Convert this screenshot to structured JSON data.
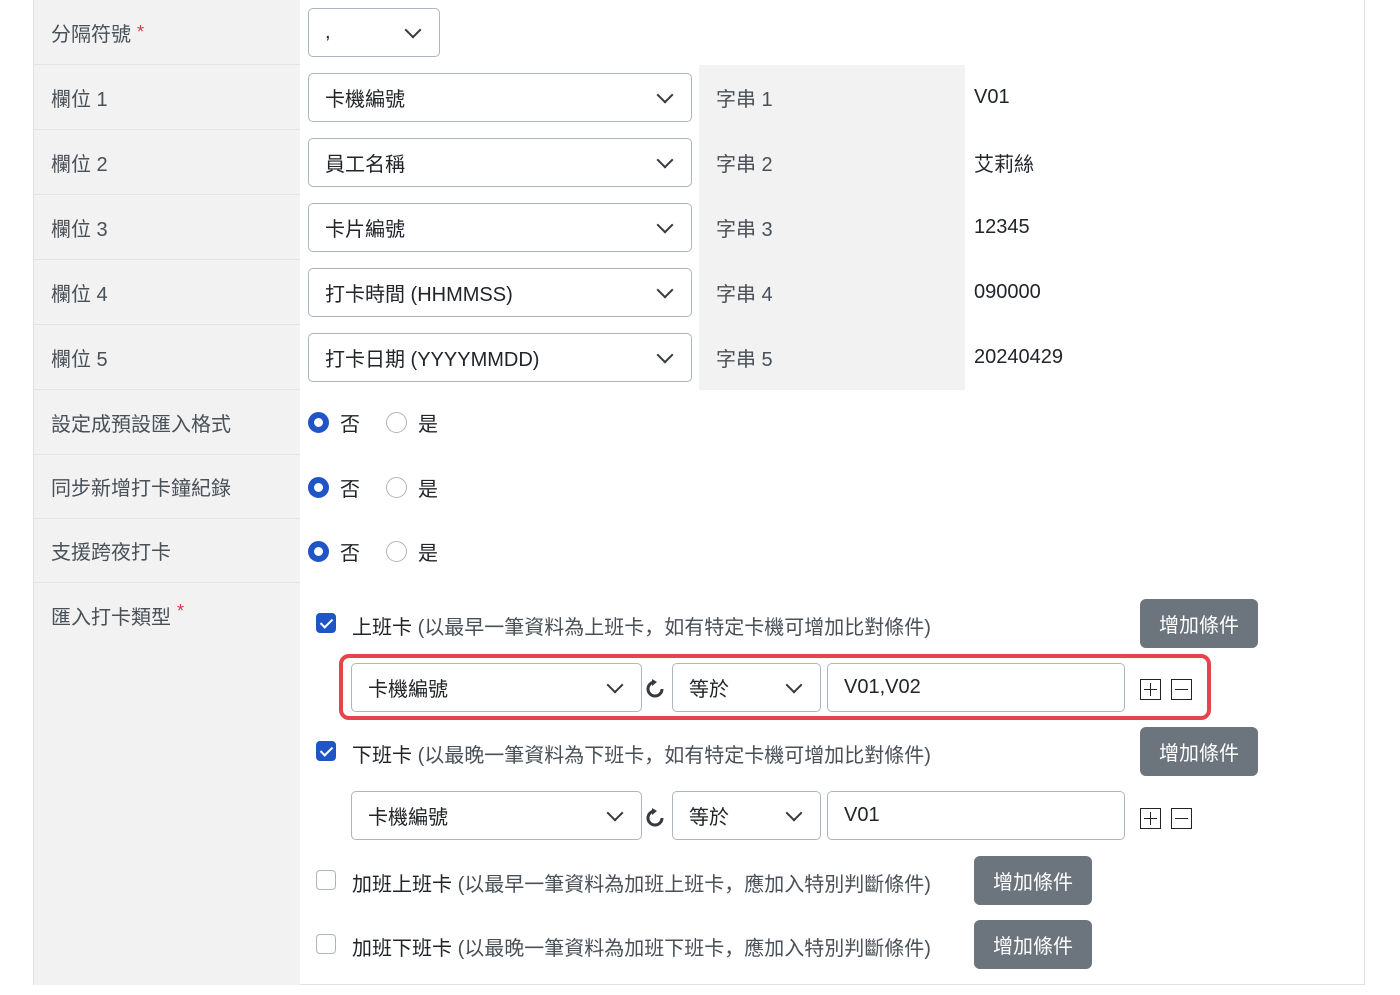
{
  "form": {
    "delimiter": {
      "label": "分隔符號",
      "required": "*",
      "value": ","
    },
    "fields": [
      {
        "label": "欄位 1",
        "select": "卡機編號",
        "str_label": "字串 1",
        "str_value": "V01"
      },
      {
        "label": "欄位 2",
        "select": "員工名稱",
        "str_label": "字串 2",
        "str_value": "艾莉絲"
      },
      {
        "label": "欄位 3",
        "select": "卡片編號",
        "str_label": "字串 3",
        "str_value": "12345"
      },
      {
        "label": "欄位 4",
        "select": "打卡時間 (HHMMSS)",
        "str_label": "字串 4",
        "str_value": "090000"
      },
      {
        "label": "欄位 5",
        "select": "打卡日期 (YYYYMMDD)",
        "str_label": "字串 5",
        "str_value": "20240429"
      }
    ],
    "options": [
      {
        "label": "設定成預設匯入格式",
        "no": "否",
        "yes": "是",
        "selected": "否"
      },
      {
        "label": "同步新增打卡鐘紀錄",
        "no": "否",
        "yes": "是",
        "selected": "否"
      },
      {
        "label": "支援跨夜打卡",
        "no": "否",
        "yes": "是",
        "selected": "否"
      }
    ],
    "punch_types": {
      "label": "匯入打卡類型",
      "required": "*",
      "add_button": "增加條件",
      "items": [
        {
          "name": "上班卡",
          "desc": "(以最早一筆資料為上班卡，如有特定卡機可增加比對條件)",
          "checked": true,
          "condition": {
            "field": "卡機編號",
            "operator": "等於",
            "value": "V01,V02"
          }
        },
        {
          "name": "下班卡",
          "desc": "(以最晚一筆資料為下班卡，如有特定卡機可增加比對條件)",
          "checked": true,
          "condition": {
            "field": "卡機編號",
            "operator": "等於",
            "value": "V01"
          }
        },
        {
          "name": "加班上班卡",
          "desc": "(以最早一筆資料為加班上班卡，應加入特別判斷條件)",
          "checked": false
        },
        {
          "name": "加班下班卡",
          "desc": "(以最晚一筆資料為加班下班卡，應加入特別判斷條件)",
          "checked": false
        }
      ]
    }
  },
  "colors": {
    "accent": "#1f55c6",
    "button": "#6c757d",
    "highlight": "#e8424a",
    "label_bg": "#f2f2f2"
  },
  "icons": {
    "refresh": "refresh-icon",
    "plus": "plus-square-icon",
    "minus": "minus-square-icon",
    "chevron": "chevron-down-icon"
  }
}
